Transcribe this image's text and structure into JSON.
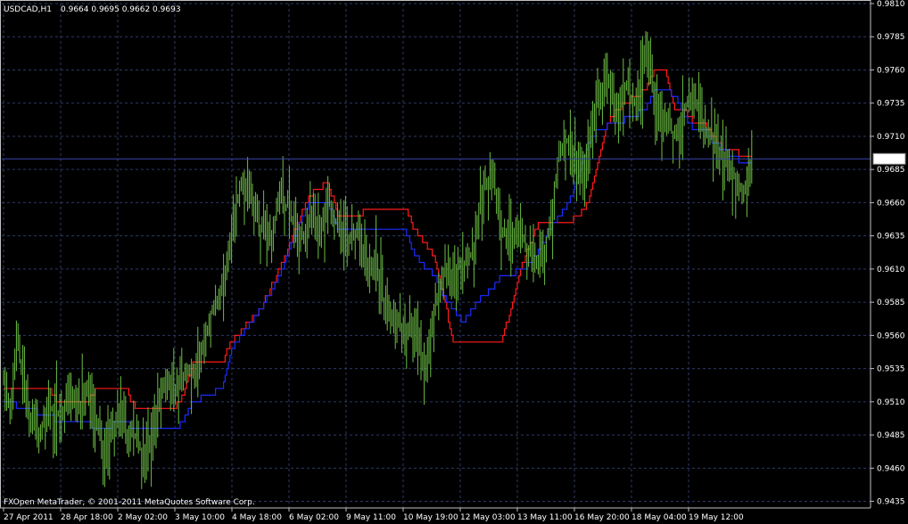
{
  "header": {
    "symbol": "USDCAD,H1",
    "ohlc": "0.9664 0.9695 0.9662 0.9693"
  },
  "footer": {
    "copyright": "FXOpen MetaTrader, © 2001-2011 MetaQuotes Software Corp."
  },
  "colors": {
    "background": "#000000",
    "grid": "#2e3a66",
    "axis": "#c0c0c0",
    "bars": "#6cbe45",
    "upper_channel": "#ff1a1a",
    "lower_channel": "#1a2cff",
    "price_line": "#3a46b0",
    "price_tag_bg": "#ffffff"
  },
  "chart_data": {
    "type": "bar",
    "style": "ohlc-price-bars",
    "grid": true,
    "ylim": [
      0.943,
      0.981
    ],
    "y_ticks": [
      "0.9810",
      "0.9785",
      "0.9760",
      "0.9735",
      "0.9710",
      "0.9685",
      "0.9660",
      "0.9635",
      "0.9610",
      "0.9585",
      "0.9560",
      "0.9535",
      "0.9510",
      "0.9485",
      "0.9460",
      "0.9435"
    ],
    "x_ticks": [
      "27 Apr 2011",
      "28 Apr 18:00",
      "2 May 02:00",
      "3 May 10:00",
      "4 May 18:00",
      "6 May 02:00",
      "9 May 11:00",
      "10 May 19:00",
      "12 May 03:00",
      "13 May 11:00",
      "16 May 20:00",
      "18 May 04:00",
      "19 May 12:00"
    ],
    "current_price": "0.9693",
    "anchors": [
      [
        0,
        0.9525
      ],
      [
        4,
        0.9505
      ],
      [
        8,
        0.9555
      ],
      [
        12,
        0.953
      ],
      [
        16,
        0.9495
      ],
      [
        22,
        0.9485
      ],
      [
        28,
        0.9505
      ],
      [
        34,
        0.95
      ],
      [
        40,
        0.951
      ],
      [
        46,
        0.9505
      ],
      [
        52,
        0.9515
      ],
      [
        58,
        0.949
      ],
      [
        64,
        0.947
      ],
      [
        70,
        0.95
      ],
      [
        76,
        0.949
      ],
      [
        82,
        0.9485
      ],
      [
        88,
        0.9465
      ],
      [
        94,
        0.95
      ],
      [
        100,
        0.9525
      ],
      [
        106,
        0.9515
      ],
      [
        112,
        0.953
      ],
      [
        118,
        0.9535
      ],
      [
        124,
        0.955
      ],
      [
        130,
        0.958
      ],
      [
        136,
        0.959
      ],
      [
        142,
        0.964
      ],
      [
        148,
        0.9675
      ],
      [
        154,
        0.966
      ],
      [
        160,
        0.964
      ],
      [
        166,
        0.963
      ],
      [
        172,
        0.9665
      ],
      [
        178,
        0.9655
      ],
      [
        184,
        0.9625
      ],
      [
        190,
        0.965
      ],
      [
        196,
        0.9635
      ],
      [
        202,
        0.966
      ],
      [
        208,
        0.9645
      ],
      [
        214,
        0.963
      ],
      [
        220,
        0.964
      ],
      [
        226,
        0.961
      ],
      [
        232,
        0.9615
      ],
      [
        238,
        0.958
      ],
      [
        244,
        0.9575
      ],
      [
        250,
        0.956
      ],
      [
        256,
        0.957
      ],
      [
        262,
        0.953
      ],
      [
        268,
        0.958
      ],
      [
        274,
        0.961
      ],
      [
        280,
        0.96
      ],
      [
        286,
        0.9615
      ],
      [
        292,
        0.962
      ],
      [
        298,
        0.967
      ],
      [
        304,
        0.968
      ],
      [
        310,
        0.964
      ],
      [
        316,
        0.963
      ],
      [
        322,
        0.964
      ],
      [
        328,
        0.962
      ],
      [
        334,
        0.9615
      ],
      [
        340,
        0.964
      ],
      [
        346,
        0.97
      ],
      [
        352,
        0.971
      ],
      [
        358,
        0.9685
      ],
      [
        364,
        0.97
      ],
      [
        370,
        0.974
      ],
      [
        376,
        0.975
      ],
      [
        382,
        0.973
      ],
      [
        388,
        0.9745
      ],
      [
        394,
        0.9735
      ],
      [
        400,
        0.9775
      ],
      [
        406,
        0.973
      ],
      [
        412,
        0.972
      ],
      [
        418,
        0.971
      ],
      [
        424,
        0.973
      ],
      [
        430,
        0.9745
      ],
      [
        436,
        0.972
      ],
      [
        442,
        0.971
      ],
      [
        448,
        0.969
      ],
      [
        454,
        0.9685
      ],
      [
        460,
        0.9665
      ],
      [
        466,
        0.9693
      ]
    ],
    "upper_channel": [
      [
        0,
        0.952
      ],
      [
        28,
        0.952
      ],
      [
        34,
        0.951
      ],
      [
        52,
        0.951
      ],
      [
        58,
        0.952
      ],
      [
        76,
        0.952
      ],
      [
        82,
        0.9505
      ],
      [
        106,
        0.9505
      ],
      [
        112,
        0.9515
      ],
      [
        118,
        0.954
      ],
      [
        136,
        0.954
      ],
      [
        142,
        0.9555
      ],
      [
        160,
        0.958
      ],
      [
        172,
        0.961
      ],
      [
        190,
        0.9665
      ],
      [
        202,
        0.9675
      ],
      [
        208,
        0.965
      ],
      [
        214,
        0.965
      ],
      [
        232,
        0.9655
      ],
      [
        250,
        0.9655
      ],
      [
        256,
        0.964
      ],
      [
        268,
        0.962
      ],
      [
        274,
        0.959
      ],
      [
        280,
        0.9555
      ],
      [
        286,
        0.9555
      ],
      [
        292,
        0.9555
      ],
      [
        298,
        0.9555
      ],
      [
        304,
        0.9555
      ],
      [
        310,
        0.9555
      ],
      [
        316,
        0.958
      ],
      [
        322,
        0.961
      ],
      [
        328,
        0.963
      ],
      [
        334,
        0.9645
      ],
      [
        340,
        0.9645
      ],
      [
        346,
        0.9645
      ],
      [
        352,
        0.9645
      ],
      [
        358,
        0.965
      ],
      [
        364,
        0.966
      ],
      [
        370,
        0.969
      ],
      [
        376,
        0.972
      ],
      [
        382,
        0.973
      ],
      [
        400,
        0.9745
      ],
      [
        406,
        0.976
      ],
      [
        412,
        0.976
      ],
      [
        418,
        0.973
      ],
      [
        424,
        0.973
      ],
      [
        430,
        0.972
      ],
      [
        436,
        0.972
      ],
      [
        442,
        0.971
      ],
      [
        448,
        0.97
      ],
      [
        454,
        0.97
      ],
      [
        460,
        0.9695
      ],
      [
        466,
        0.9695
      ]
    ],
    "lower_channel": [
      [
        0,
        0.951
      ],
      [
        28,
        0.95
      ],
      [
        34,
        0.9495
      ],
      [
        52,
        0.9495
      ],
      [
        58,
        0.949
      ],
      [
        76,
        0.9495
      ],
      [
        82,
        0.949
      ],
      [
        106,
        0.949
      ],
      [
        112,
        0.9495
      ],
      [
        118,
        0.951
      ],
      [
        136,
        0.952
      ],
      [
        142,
        0.955
      ],
      [
        160,
        0.958
      ],
      [
        172,
        0.9605
      ],
      [
        178,
        0.9625
      ],
      [
        190,
        0.966
      ],
      [
        202,
        0.966
      ],
      [
        208,
        0.964
      ],
      [
        214,
        0.964
      ],
      [
        232,
        0.964
      ],
      [
        250,
        0.964
      ],
      [
        256,
        0.962
      ],
      [
        268,
        0.9605
      ],
      [
        274,
        0.959
      ],
      [
        280,
        0.958
      ],
      [
        286,
        0.957
      ],
      [
        292,
        0.958
      ],
      [
        298,
        0.959
      ],
      [
        304,
        0.9595
      ],
      [
        310,
        0.9605
      ],
      [
        316,
        0.9605
      ],
      [
        322,
        0.961
      ],
      [
        328,
        0.9615
      ],
      [
        334,
        0.9625
      ],
      [
        340,
        0.964
      ],
      [
        346,
        0.965
      ],
      [
        352,
        0.966
      ],
      [
        358,
        0.968
      ],
      [
        364,
        0.9705
      ],
      [
        370,
        0.9715
      ],
      [
        382,
        0.972
      ],
      [
        400,
        0.973
      ],
      [
        406,
        0.9745
      ],
      [
        412,
        0.9745
      ],
      [
        418,
        0.974
      ],
      [
        424,
        0.9725
      ],
      [
        430,
        0.9715
      ],
      [
        436,
        0.9715
      ],
      [
        442,
        0.9705
      ],
      [
        448,
        0.97
      ],
      [
        454,
        0.9695
      ],
      [
        460,
        0.969
      ],
      [
        466,
        0.969
      ]
    ]
  }
}
